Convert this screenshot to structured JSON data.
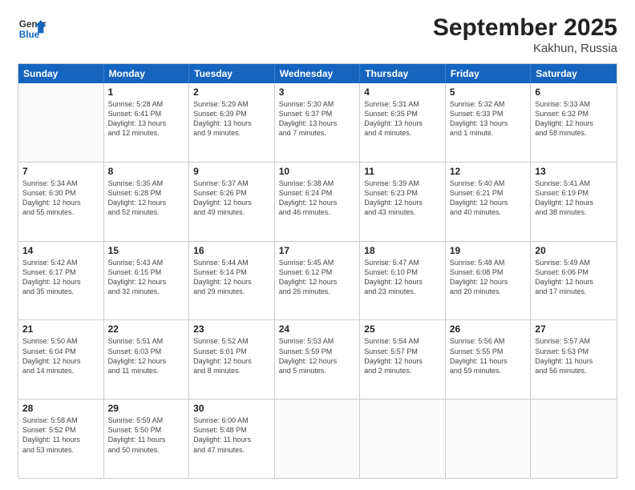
{
  "logo": {
    "line1": "General",
    "line2": "Blue"
  },
  "title": "September 2025",
  "subtitle": "Kakhun, Russia",
  "days": [
    "Sunday",
    "Monday",
    "Tuesday",
    "Wednesday",
    "Thursday",
    "Friday",
    "Saturday"
  ],
  "rows": [
    [
      {
        "empty": true
      },
      {
        "day": 1,
        "lines": [
          "Sunrise: 5:28 AM",
          "Sunset: 6:41 PM",
          "Daylight: 13 hours",
          "and 12 minutes."
        ]
      },
      {
        "day": 2,
        "lines": [
          "Sunrise: 5:29 AM",
          "Sunset: 6:39 PM",
          "Daylight: 13 hours",
          "and 9 minutes."
        ]
      },
      {
        "day": 3,
        "lines": [
          "Sunrise: 5:30 AM",
          "Sunset: 6:37 PM",
          "Daylight: 13 hours",
          "and 7 minutes."
        ]
      },
      {
        "day": 4,
        "lines": [
          "Sunrise: 5:31 AM",
          "Sunset: 6:35 PM",
          "Daylight: 13 hours",
          "and 4 minutes."
        ]
      },
      {
        "day": 5,
        "lines": [
          "Sunrise: 5:32 AM",
          "Sunset: 6:33 PM",
          "Daylight: 13 hours",
          "and 1 minute."
        ]
      },
      {
        "day": 6,
        "lines": [
          "Sunrise: 5:33 AM",
          "Sunset: 6:32 PM",
          "Daylight: 12 hours",
          "and 58 minutes."
        ]
      }
    ],
    [
      {
        "day": 7,
        "lines": [
          "Sunrise: 5:34 AM",
          "Sunset: 6:30 PM",
          "Daylight: 12 hours",
          "and 55 minutes."
        ]
      },
      {
        "day": 8,
        "lines": [
          "Sunrise: 5:35 AM",
          "Sunset: 6:28 PM",
          "Daylight: 12 hours",
          "and 52 minutes."
        ]
      },
      {
        "day": 9,
        "lines": [
          "Sunrise: 5:37 AM",
          "Sunset: 6:26 PM",
          "Daylight: 12 hours",
          "and 49 minutes."
        ]
      },
      {
        "day": 10,
        "lines": [
          "Sunrise: 5:38 AM",
          "Sunset: 6:24 PM",
          "Daylight: 12 hours",
          "and 46 minutes."
        ]
      },
      {
        "day": 11,
        "lines": [
          "Sunrise: 5:39 AM",
          "Sunset: 6:23 PM",
          "Daylight: 12 hours",
          "and 43 minutes."
        ]
      },
      {
        "day": 12,
        "lines": [
          "Sunrise: 5:40 AM",
          "Sunset: 6:21 PM",
          "Daylight: 12 hours",
          "and 40 minutes."
        ]
      },
      {
        "day": 13,
        "lines": [
          "Sunrise: 5:41 AM",
          "Sunset: 6:19 PM",
          "Daylight: 12 hours",
          "and 38 minutes."
        ]
      }
    ],
    [
      {
        "day": 14,
        "lines": [
          "Sunrise: 5:42 AM",
          "Sunset: 6:17 PM",
          "Daylight: 12 hours",
          "and 35 minutes."
        ]
      },
      {
        "day": 15,
        "lines": [
          "Sunrise: 5:43 AM",
          "Sunset: 6:15 PM",
          "Daylight: 12 hours",
          "and 32 minutes."
        ]
      },
      {
        "day": 16,
        "lines": [
          "Sunrise: 5:44 AM",
          "Sunset: 6:14 PM",
          "Daylight: 12 hours",
          "and 29 minutes."
        ]
      },
      {
        "day": 17,
        "lines": [
          "Sunrise: 5:45 AM",
          "Sunset: 6:12 PM",
          "Daylight: 12 hours",
          "and 26 minutes."
        ]
      },
      {
        "day": 18,
        "lines": [
          "Sunrise: 5:47 AM",
          "Sunset: 6:10 PM",
          "Daylight: 12 hours",
          "and 23 minutes."
        ]
      },
      {
        "day": 19,
        "lines": [
          "Sunrise: 5:48 AM",
          "Sunset: 6:08 PM",
          "Daylight: 12 hours",
          "and 20 minutes."
        ]
      },
      {
        "day": 20,
        "lines": [
          "Sunrise: 5:49 AM",
          "Sunset: 6:06 PM",
          "Daylight: 12 hours",
          "and 17 minutes."
        ]
      }
    ],
    [
      {
        "day": 21,
        "lines": [
          "Sunrise: 5:50 AM",
          "Sunset: 6:04 PM",
          "Daylight: 12 hours",
          "and 14 minutes."
        ]
      },
      {
        "day": 22,
        "lines": [
          "Sunrise: 5:51 AM",
          "Sunset: 6:03 PM",
          "Daylight: 12 hours",
          "and 11 minutes."
        ]
      },
      {
        "day": 23,
        "lines": [
          "Sunrise: 5:52 AM",
          "Sunset: 6:01 PM",
          "Daylight: 12 hours",
          "and 8 minutes."
        ]
      },
      {
        "day": 24,
        "lines": [
          "Sunrise: 5:53 AM",
          "Sunset: 5:59 PM",
          "Daylight: 12 hours",
          "and 5 minutes."
        ]
      },
      {
        "day": 25,
        "lines": [
          "Sunrise: 5:54 AM",
          "Sunset: 5:57 PM",
          "Daylight: 12 hours",
          "and 2 minutes."
        ]
      },
      {
        "day": 26,
        "lines": [
          "Sunrise: 5:56 AM",
          "Sunset: 5:55 PM",
          "Daylight: 11 hours",
          "and 59 minutes."
        ]
      },
      {
        "day": 27,
        "lines": [
          "Sunrise: 5:57 AM",
          "Sunset: 5:53 PM",
          "Daylight: 11 hours",
          "and 56 minutes."
        ]
      }
    ],
    [
      {
        "day": 28,
        "lines": [
          "Sunrise: 5:58 AM",
          "Sunset: 5:52 PM",
          "Daylight: 11 hours",
          "and 53 minutes."
        ]
      },
      {
        "day": 29,
        "lines": [
          "Sunrise: 5:59 AM",
          "Sunset: 5:50 PM",
          "Daylight: 11 hours",
          "and 50 minutes."
        ]
      },
      {
        "day": 30,
        "lines": [
          "Sunrise: 6:00 AM",
          "Sunset: 5:48 PM",
          "Daylight: 11 hours",
          "and 47 minutes."
        ]
      },
      {
        "empty": true
      },
      {
        "empty": true
      },
      {
        "empty": true
      },
      {
        "empty": true
      }
    ]
  ]
}
